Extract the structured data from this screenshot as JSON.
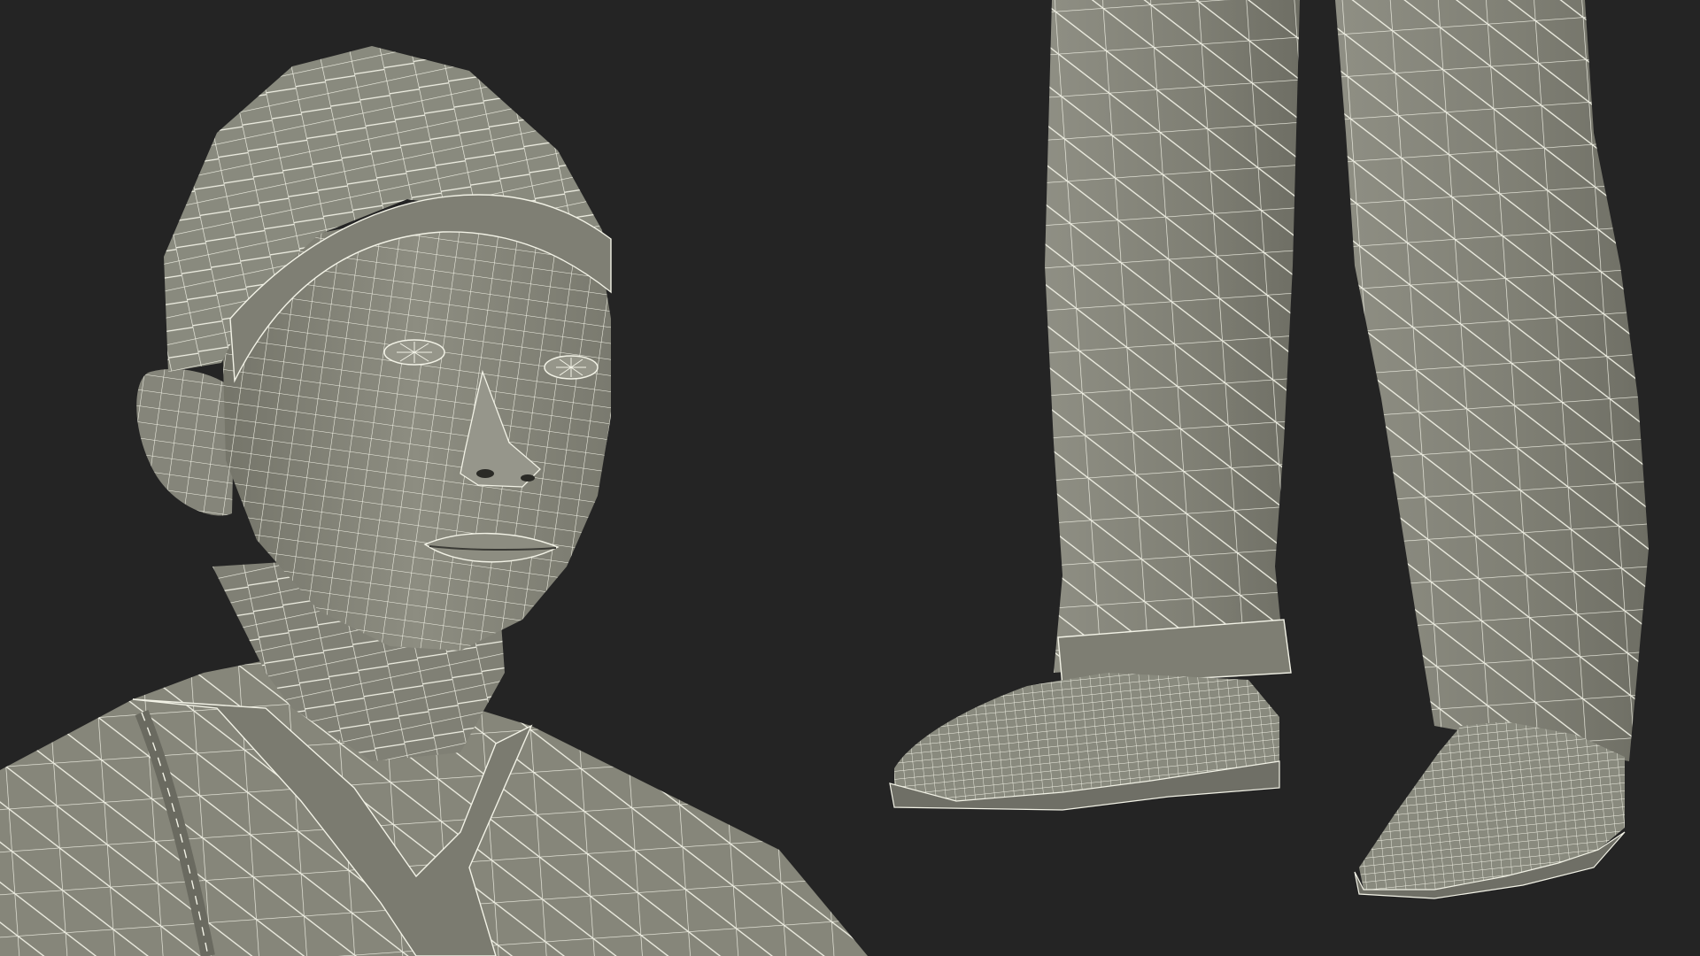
{
  "image": {
    "description_visible_text": "",
    "colors": {
      "background": "#242424",
      "surface": "#8c8c80",
      "surface_shadow": "#6f6f64",
      "surface_light": "#a7a79a",
      "wire": "#f2f2e6",
      "hole": "#2a2a26"
    }
  }
}
